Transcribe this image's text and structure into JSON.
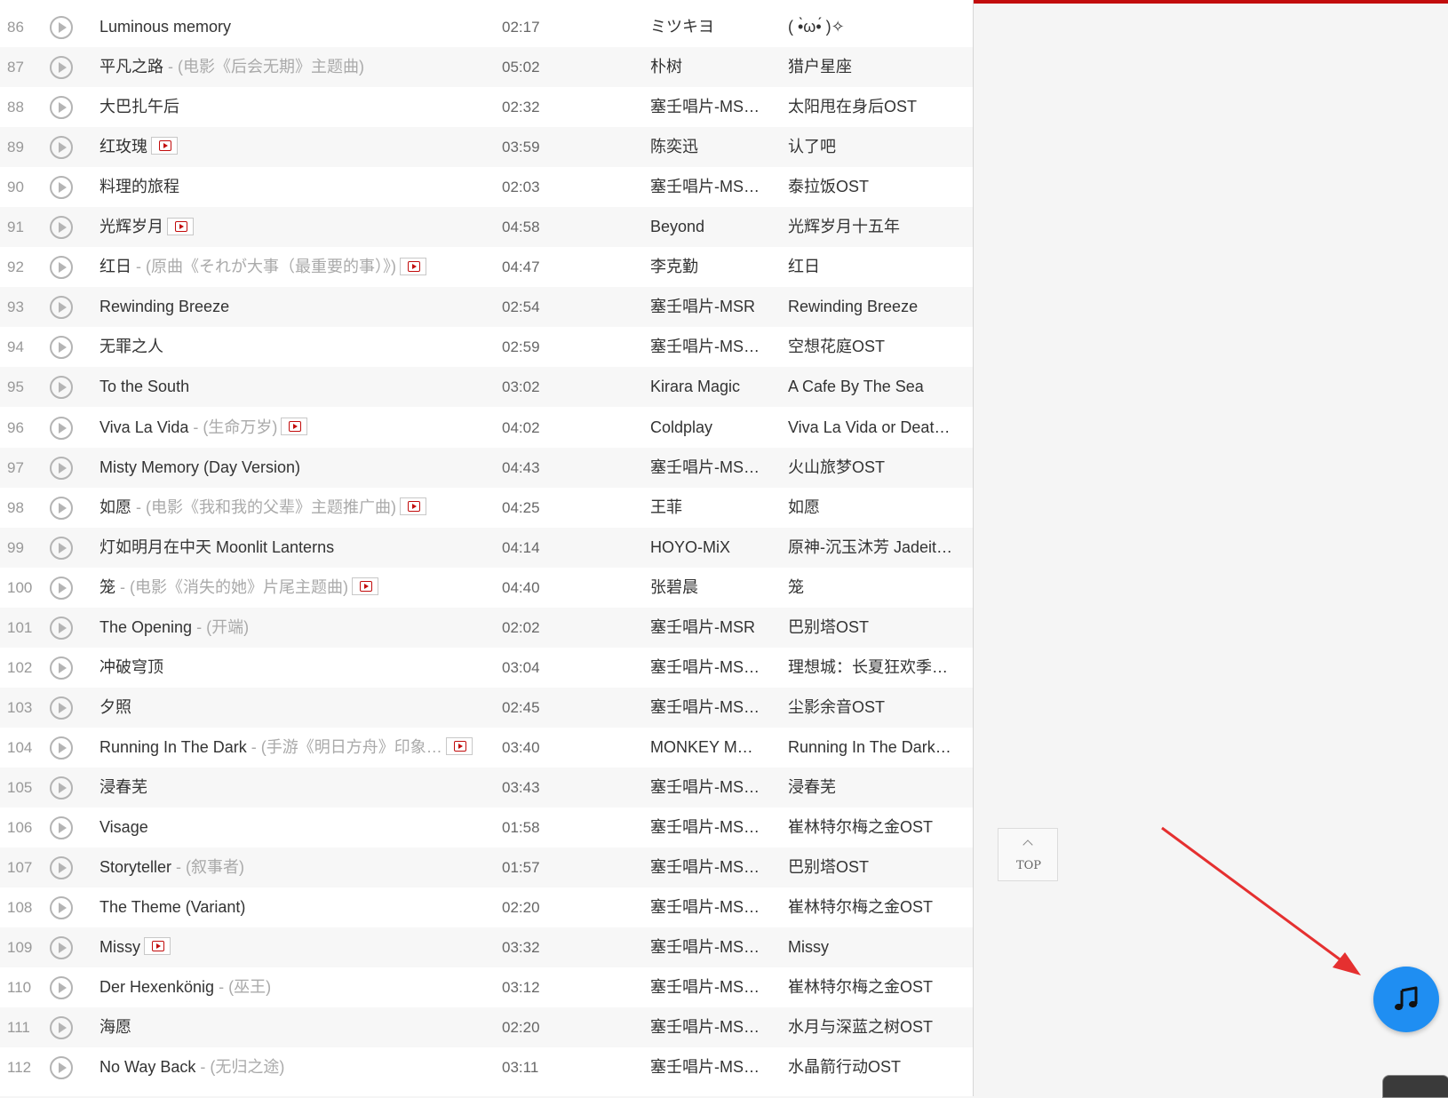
{
  "colors": {
    "accent": "#c20c0c",
    "music_button": "#1f8ef2",
    "annotation_arrow": "#e53030"
  },
  "top_button": {
    "label": "TOP"
  },
  "songs": [
    {
      "idx": "86",
      "title": "Luminous memory",
      "sub": "",
      "mv": false,
      "duration": "02:17",
      "artist": "ミツキヨ",
      "album": "( •̀ω•́ )✧"
    },
    {
      "idx": "87",
      "title": "平凡之路",
      "sub": " - (电影《后会无期》主题曲)",
      "mv": false,
      "duration": "05:02",
      "artist": "朴树",
      "album": "猎户星座"
    },
    {
      "idx": "88",
      "title": "大巴扎午后",
      "sub": "",
      "mv": false,
      "duration": "02:32",
      "artist": "塞壬唱片-MS…",
      "album": "太阳甩在身后OST"
    },
    {
      "idx": "89",
      "title": "红玫瑰",
      "sub": "",
      "mv": true,
      "duration": "03:59",
      "artist": "陈奕迅",
      "album": "认了吧"
    },
    {
      "idx": "90",
      "title": "料理的旅程",
      "sub": "",
      "mv": false,
      "duration": "02:03",
      "artist": "塞壬唱片-MS…",
      "album": "泰拉饭OST"
    },
    {
      "idx": "91",
      "title": "光辉岁月",
      "sub": "",
      "mv": true,
      "duration": "04:58",
      "artist": "Beyond",
      "album": "光辉岁月十五年"
    },
    {
      "idx": "92",
      "title": "红日",
      "sub": " - (原曲《それが大事（最重要的事）》)",
      "mv": true,
      "duration": "04:47",
      "artist": "李克勤",
      "album": "红日"
    },
    {
      "idx": "93",
      "title": "Rewinding Breeze",
      "sub": "",
      "mv": false,
      "duration": "02:54",
      "artist": "塞壬唱片-MSR",
      "album": "Rewinding Breeze"
    },
    {
      "idx": "94",
      "title": "无罪之人",
      "sub": "",
      "mv": false,
      "duration": "02:59",
      "artist": "塞壬唱片-MS…",
      "album": "空想花庭OST"
    },
    {
      "idx": "95",
      "title": "To the South",
      "sub": "",
      "mv": false,
      "duration": "03:02",
      "artist": "Kirara Magic",
      "album": "A Cafe By The Sea"
    },
    {
      "idx": "96",
      "title": "Viva La Vida",
      "sub": " - (生命万岁)",
      "mv": true,
      "duration": "04:02",
      "artist": "Coldplay",
      "album": "Viva La Vida or Deat…"
    },
    {
      "idx": "97",
      "title": "Misty Memory (Day Version)",
      "sub": "",
      "mv": false,
      "duration": "04:43",
      "artist": "塞壬唱片-MS…",
      "album": "火山旅梦OST"
    },
    {
      "idx": "98",
      "title": "如愿",
      "sub": " - (电影《我和我的父辈》主题推广曲)",
      "mv": true,
      "duration": "04:25",
      "artist": "王菲",
      "album": "如愿"
    },
    {
      "idx": "99",
      "title": "灯如明月在中天 Moonlit Lanterns",
      "sub": "",
      "mv": false,
      "duration": "04:14",
      "artist": "HOYO-MiX",
      "album": "原神-沉玉沐芳 Jadeit…"
    },
    {
      "idx": "100",
      "title": "笼",
      "sub": " - (电影《消失的她》片尾主题曲)",
      "mv": true,
      "duration": "04:40",
      "artist": "张碧晨",
      "album": "笼"
    },
    {
      "idx": "101",
      "title": "The Opening",
      "sub": " - (开端)",
      "mv": false,
      "duration": "02:02",
      "artist": "塞壬唱片-MSR",
      "album": "巴别塔OST"
    },
    {
      "idx": "102",
      "title": "冲破穹顶",
      "sub": "",
      "mv": false,
      "duration": "03:04",
      "artist": "塞壬唱片-MS…",
      "album": "理想城：长夏狂欢季…"
    },
    {
      "idx": "103",
      "title": "夕照",
      "sub": "",
      "mv": false,
      "duration": "02:45",
      "artist": "塞壬唱片-MS…",
      "album": "尘影余音OST"
    },
    {
      "idx": "104",
      "title": "Running In The Dark",
      "sub": " - (手游《明日方舟》印象…",
      "mv": true,
      "duration": "03:40",
      "artist": "MONKEY M…",
      "album": "Running In The Dark…"
    },
    {
      "idx": "105",
      "title": "浸春芜",
      "sub": "",
      "mv": false,
      "duration": "03:43",
      "artist": "塞壬唱片-MS…",
      "album": "浸春芜"
    },
    {
      "idx": "106",
      "title": "Visage",
      "sub": "",
      "mv": false,
      "duration": "01:58",
      "artist": "塞壬唱片-MS…",
      "album": "崔林特尔梅之金OST"
    },
    {
      "idx": "107",
      "title": "Storyteller",
      "sub": " - (叙事者)",
      "mv": false,
      "duration": "01:57",
      "artist": "塞壬唱片-MS…",
      "album": "巴别塔OST"
    },
    {
      "idx": "108",
      "title": "The Theme (Variant)",
      "sub": "",
      "mv": false,
      "duration": "02:20",
      "artist": "塞壬唱片-MS…",
      "album": "崔林特尔梅之金OST"
    },
    {
      "idx": "109",
      "title": "Missy",
      "sub": "",
      "mv": true,
      "duration": "03:32",
      "artist": "塞壬唱片-MS…",
      "album": "Missy"
    },
    {
      "idx": "110",
      "title": "Der Hexenkönig",
      "sub": " - (巫王)",
      "mv": false,
      "duration": "03:12",
      "artist": "塞壬唱片-MS…",
      "album": "崔林特尔梅之金OST"
    },
    {
      "idx": "111",
      "title": "海愿",
      "sub": "",
      "mv": false,
      "duration": "02:20",
      "artist": "塞壬唱片-MS…",
      "album": "水月与深蓝之树OST"
    },
    {
      "idx": "112",
      "title": "No Way Back",
      "sub": " - (无归之途)",
      "mv": false,
      "duration": "03:11",
      "artist": "塞壬唱片-MS…",
      "album": "水晶箭行动OST"
    }
  ]
}
